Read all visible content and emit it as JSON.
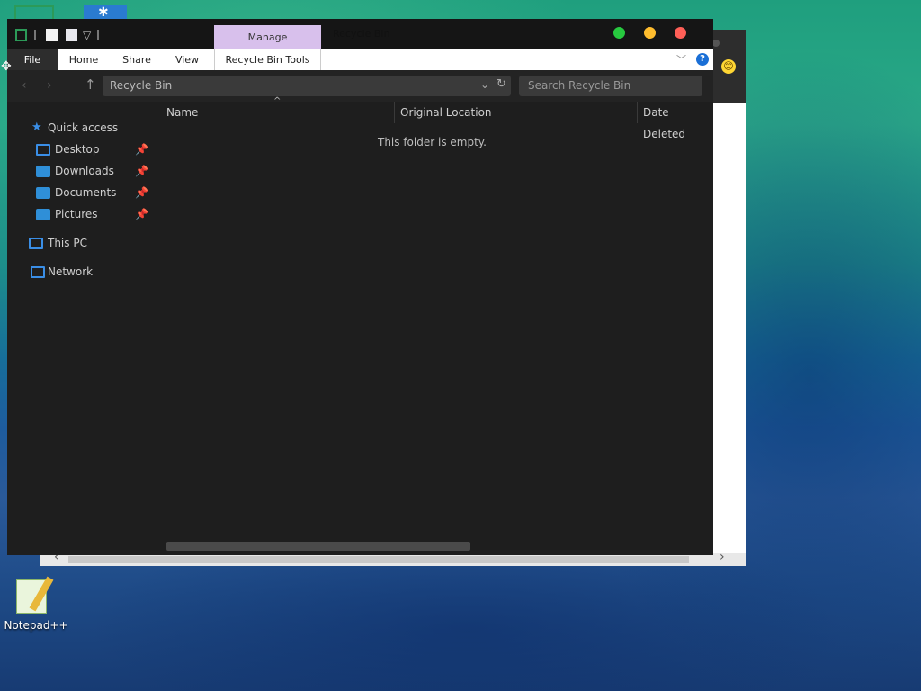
{
  "background_window": {
    "emoji": "😊"
  },
  "explorer": {
    "title": "Recycle Bin",
    "quick_access_dropdown": "▽",
    "context_tab": "Manage",
    "window_controls": {
      "close": "",
      "minimize": "",
      "maximize": ""
    },
    "ribbon": {
      "file": "File",
      "home": "Home",
      "share": "Share",
      "view": "View",
      "tools": "Recycle Bin Tools",
      "expand": "﹀",
      "help": "?"
    },
    "address_bar": {
      "back": "‹",
      "forward": "›",
      "up": "↑",
      "path": "Recycle Bin",
      "dropdown": "⌄",
      "refresh": "↻",
      "search_placeholder": "Search Recycle Bin"
    },
    "nav": {
      "quick_access": "Quick access",
      "items": [
        {
          "label": "Desktop",
          "icon": "desktop-icon"
        },
        {
          "label": "Downloads",
          "icon": "downloads-folder-icon"
        },
        {
          "label": "Documents",
          "icon": "documents-folder-icon"
        },
        {
          "label": "Pictures",
          "icon": "pictures-folder-icon"
        }
      ],
      "this_pc": "This PC",
      "network": "Network"
    },
    "columns": {
      "name": "Name",
      "original_location": "Original Location",
      "date_deleted": "Date Deleted"
    },
    "empty_message": "This folder is empty."
  },
  "desktop": {
    "notepad_label": "Notepad++"
  }
}
